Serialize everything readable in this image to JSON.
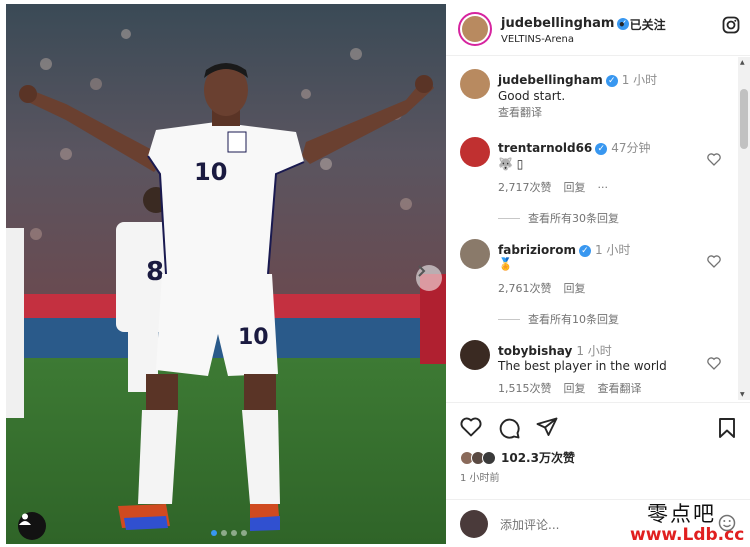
{
  "header": {
    "username": "judebellingham",
    "follow_status": "已关注",
    "location": "VELTINS-Arena"
  },
  "player": {
    "front_number": "10",
    "shorts_number": "10",
    "teammate_number": "8"
  },
  "caption": {
    "username": "judebellingham",
    "time": "1 小时",
    "text": "Good start.",
    "translate": "查看翻译"
  },
  "comments": [
    {
      "username": "trentarnold66",
      "time": "47分钟",
      "text": "🐺 ▯",
      "likes": "2,717次赞",
      "reply": "回复",
      "more": "···",
      "view_replies": "查看所有30条回复"
    },
    {
      "username": "fabriziorom",
      "time": "1 小时",
      "text": "🏅",
      "likes": "2,761次赞",
      "reply": "回复",
      "view_replies": "查看所有10条回复"
    },
    {
      "username": "tobybishay",
      "time": "1 小时",
      "text": "The best player in the world",
      "likes": "1,515次赞",
      "reply": "回复",
      "translate": "查看翻译"
    }
  ],
  "actions": {
    "likes_total": "102.3万次赞",
    "posted_ago": "1 小时前",
    "add_comment_placeholder": "添加评论..."
  },
  "watermark": {
    "top": "零点吧",
    "bottom": "www.Ldb.cc"
  },
  "icons": [
    "instagram-icon",
    "heart-icon",
    "comment-icon",
    "share-icon",
    "bookmark-icon",
    "emoji-icon",
    "user-tag-icon",
    "next-arrow-icon"
  ],
  "colors": {
    "verified": "#3897f0",
    "text": "#262626",
    "muted": "#737373",
    "pitch": "#3f7d3a",
    "watermark_red": "#e02020"
  }
}
